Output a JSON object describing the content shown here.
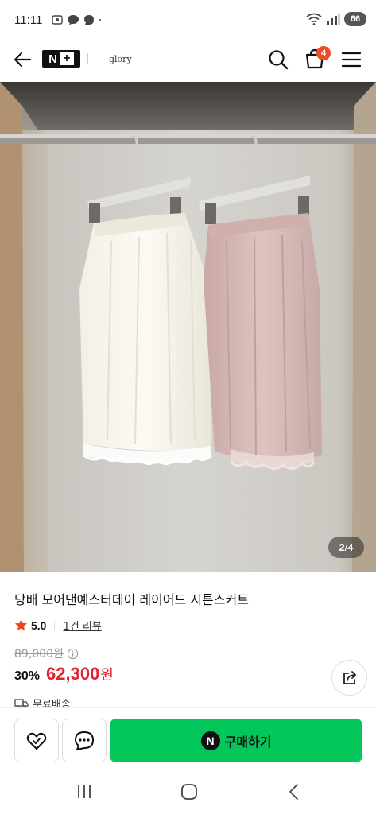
{
  "status_bar": {
    "time": "11:11",
    "battery": "66",
    "icons": [
      "screenshot-icon",
      "talk-icon",
      "chat-icon",
      "dot-icon",
      "wifi-icon",
      "signal-icon",
      "battery-icon"
    ]
  },
  "header": {
    "logo_text": "N",
    "logo_plus": "+",
    "store_name": "glory",
    "cart_count": "4"
  },
  "gallery": {
    "current": "2",
    "separator": "/",
    "total": "4"
  },
  "product": {
    "title": "당배 모어댄예스터데이 레이어드 시튼스커트",
    "rating": "5.0",
    "review_link": "1건 리뷰",
    "original_price": "89,000원",
    "discount": "30%",
    "price": "62,300",
    "price_unit": "원",
    "shipping": "무료배송"
  },
  "actions": {
    "buy_label": "구매하기",
    "npay_letter": "N"
  },
  "colors": {
    "accent_green": "#03c75a",
    "price_red": "#e4222e",
    "badge_orange": "#f04a2a"
  }
}
